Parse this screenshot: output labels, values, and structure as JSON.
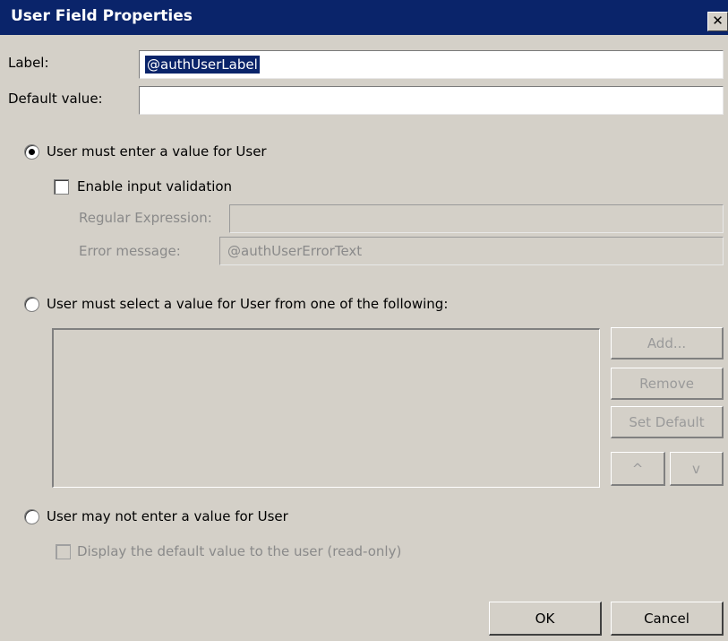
{
  "window": {
    "title": "User Field Properties",
    "close_glyph": "✕"
  },
  "label_row": {
    "label": "Label:",
    "value": "@authUserLabel"
  },
  "default_row": {
    "label": "Default value:",
    "value": ""
  },
  "option_enter": {
    "label": "User must enter a value for User",
    "checked": true,
    "validation_checkbox_label": "Enable input validation",
    "validation_checked": false,
    "regex_label": "Regular Expression:",
    "regex_value": "",
    "error_label": "Error message:",
    "error_value": "@authUserErrorText"
  },
  "option_select": {
    "label": "User must select a value for User from one of the following:",
    "checked": false,
    "list_items": [],
    "add_label": "Add...",
    "remove_label": "Remove",
    "set_default_label": "Set Default",
    "up_label": "^",
    "down_label": "v"
  },
  "option_none": {
    "label": "User may not enter a value for User",
    "checked": false,
    "display_default_label": "Display the default value to the user (read-only)",
    "display_default_checked": false
  },
  "footer": {
    "ok_label": "OK",
    "cancel_label": "Cancel"
  },
  "icons": {
    "close": "close-icon",
    "radio": "radio-icon",
    "checkbox": "checkbox-icon"
  }
}
